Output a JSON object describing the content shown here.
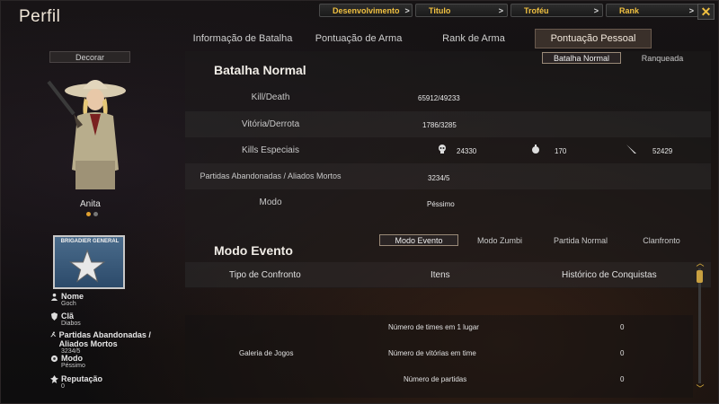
{
  "window": {
    "title": "Perfil"
  },
  "top_nav": [
    {
      "label": "Desenvolvimento"
    },
    {
      "label": "Titulo"
    },
    {
      "label": "Troféu"
    },
    {
      "label": "Rank"
    }
  ],
  "tabs": [
    {
      "label": "Informação de Batalha"
    },
    {
      "label": "Pontuação de Arma"
    },
    {
      "label": "Rank de Arma"
    },
    {
      "label": "Pontuação Pessoal"
    }
  ],
  "left": {
    "decorar": "Decorar",
    "character_name": "Anita",
    "rank_badge_text": "BRIGADIER GENERAL",
    "fields": [
      {
        "label": "Nome",
        "value": "Goch",
        "icon": "person-icon"
      },
      {
        "label": "Clã",
        "value": "Diabos",
        "icon": "clan-icon"
      },
      {
        "label": "Partidas Abandonadas / Aliados Mortos",
        "value": "3234/5",
        "icon": "running-icon"
      },
      {
        "label": "Modo",
        "value": "Péssimo",
        "icon": "mode-icon"
      },
      {
        "label": "Reputação",
        "value": "0",
        "icon": "reputation-icon"
      }
    ]
  },
  "normal": {
    "title": "Batalha Normal",
    "subtabs": [
      "Batalha Normal",
      "Ranqueada"
    ],
    "rows": {
      "kd_label": "Kill/Death",
      "kd_value": "65912/49233",
      "wl_label": "Vitória/Derrota",
      "wl_value": "1786/3285",
      "special_label": "Kills Especiais",
      "special_head": "24330",
      "special_grenade": "170",
      "special_knife": "52429",
      "abandon_label": "Partidas Abandonadas / Aliados Mortos",
      "abandon_value": "3234/5",
      "mode_label": "Modo",
      "mode_value": "Péssimo"
    }
  },
  "event": {
    "title": "Modo Evento",
    "subtabs": [
      "Modo Evento",
      "Modo Zumbi",
      "Partida Normal",
      "Clanfronto"
    ],
    "columns": [
      "Tipo de Confronto",
      "Itens",
      "Histórico de Conquistas"
    ],
    "gallery_label": "Galeria de Jogos",
    "stats": [
      {
        "label": "Número de times em 1 lugar",
        "value": "0"
      },
      {
        "label": "Número de vitórias em time",
        "value": "0"
      },
      {
        "label": "Número de partidas",
        "value": "0"
      }
    ]
  },
  "colors": {
    "accent": "#f0c040",
    "tab_active_bg": "#3a302a"
  }
}
